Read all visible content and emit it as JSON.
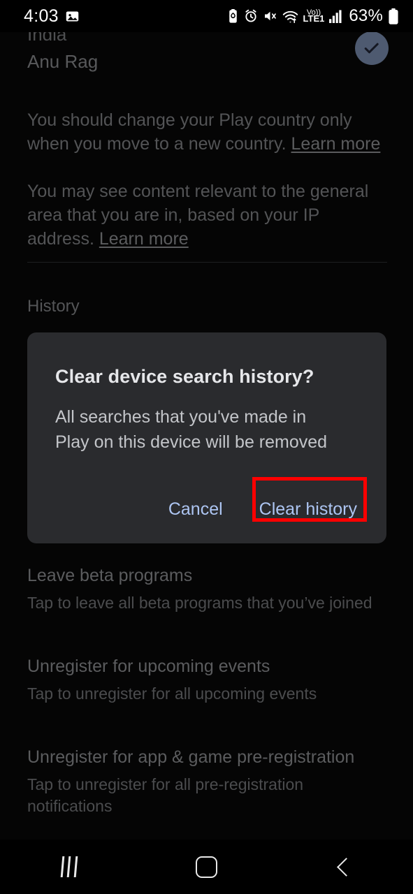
{
  "status_bar": {
    "time": "4:03",
    "battery_percent": "63%",
    "network_label": "LTE1",
    "volte_label": "Vo))",
    "icons": [
      "image-icon",
      "battery-saver-icon",
      "alarm-icon",
      "mute-icon",
      "wifi-icon",
      "volte-lte-icon",
      "signal-bars-icon",
      "battery-icon"
    ]
  },
  "account": {
    "country": "India",
    "name": "Anu Rag",
    "selected_icon": "check-circle-icon"
  },
  "info": {
    "paragraph_1": "You should change your Play country only when you move to a new country.",
    "paragraph_1_link": "Learn more",
    "paragraph_2": "You may see content relevant to the general area that you are in, based on your IP address.",
    "paragraph_2_link": "Learn more"
  },
  "sections": {
    "history_label": "History"
  },
  "list_items": [
    {
      "title": "Leave beta programs",
      "subtitle": "Tap to leave all beta programs that you’ve joined"
    },
    {
      "title": "Unregister for upcoming events",
      "subtitle": "Tap to unregister for all upcoming events"
    },
    {
      "title": "Unregister for app & game pre-registration",
      "subtitle": "Tap to unregister for all pre-registration notifications"
    }
  ],
  "dialog": {
    "title": "Clear device search history?",
    "body": "All searches that you've made in Play on this device will be removed",
    "cancel_label": "Cancel",
    "confirm_label": "Clear history",
    "accent_color": "#adc5f2",
    "surface_color": "#2a2b2e"
  },
  "annotation": {
    "highlight_color": "#fe0000",
    "target": "Clear history"
  },
  "nav_bar": {
    "recents_label": "Recents",
    "home_label": "Home",
    "back_label": "Back"
  }
}
